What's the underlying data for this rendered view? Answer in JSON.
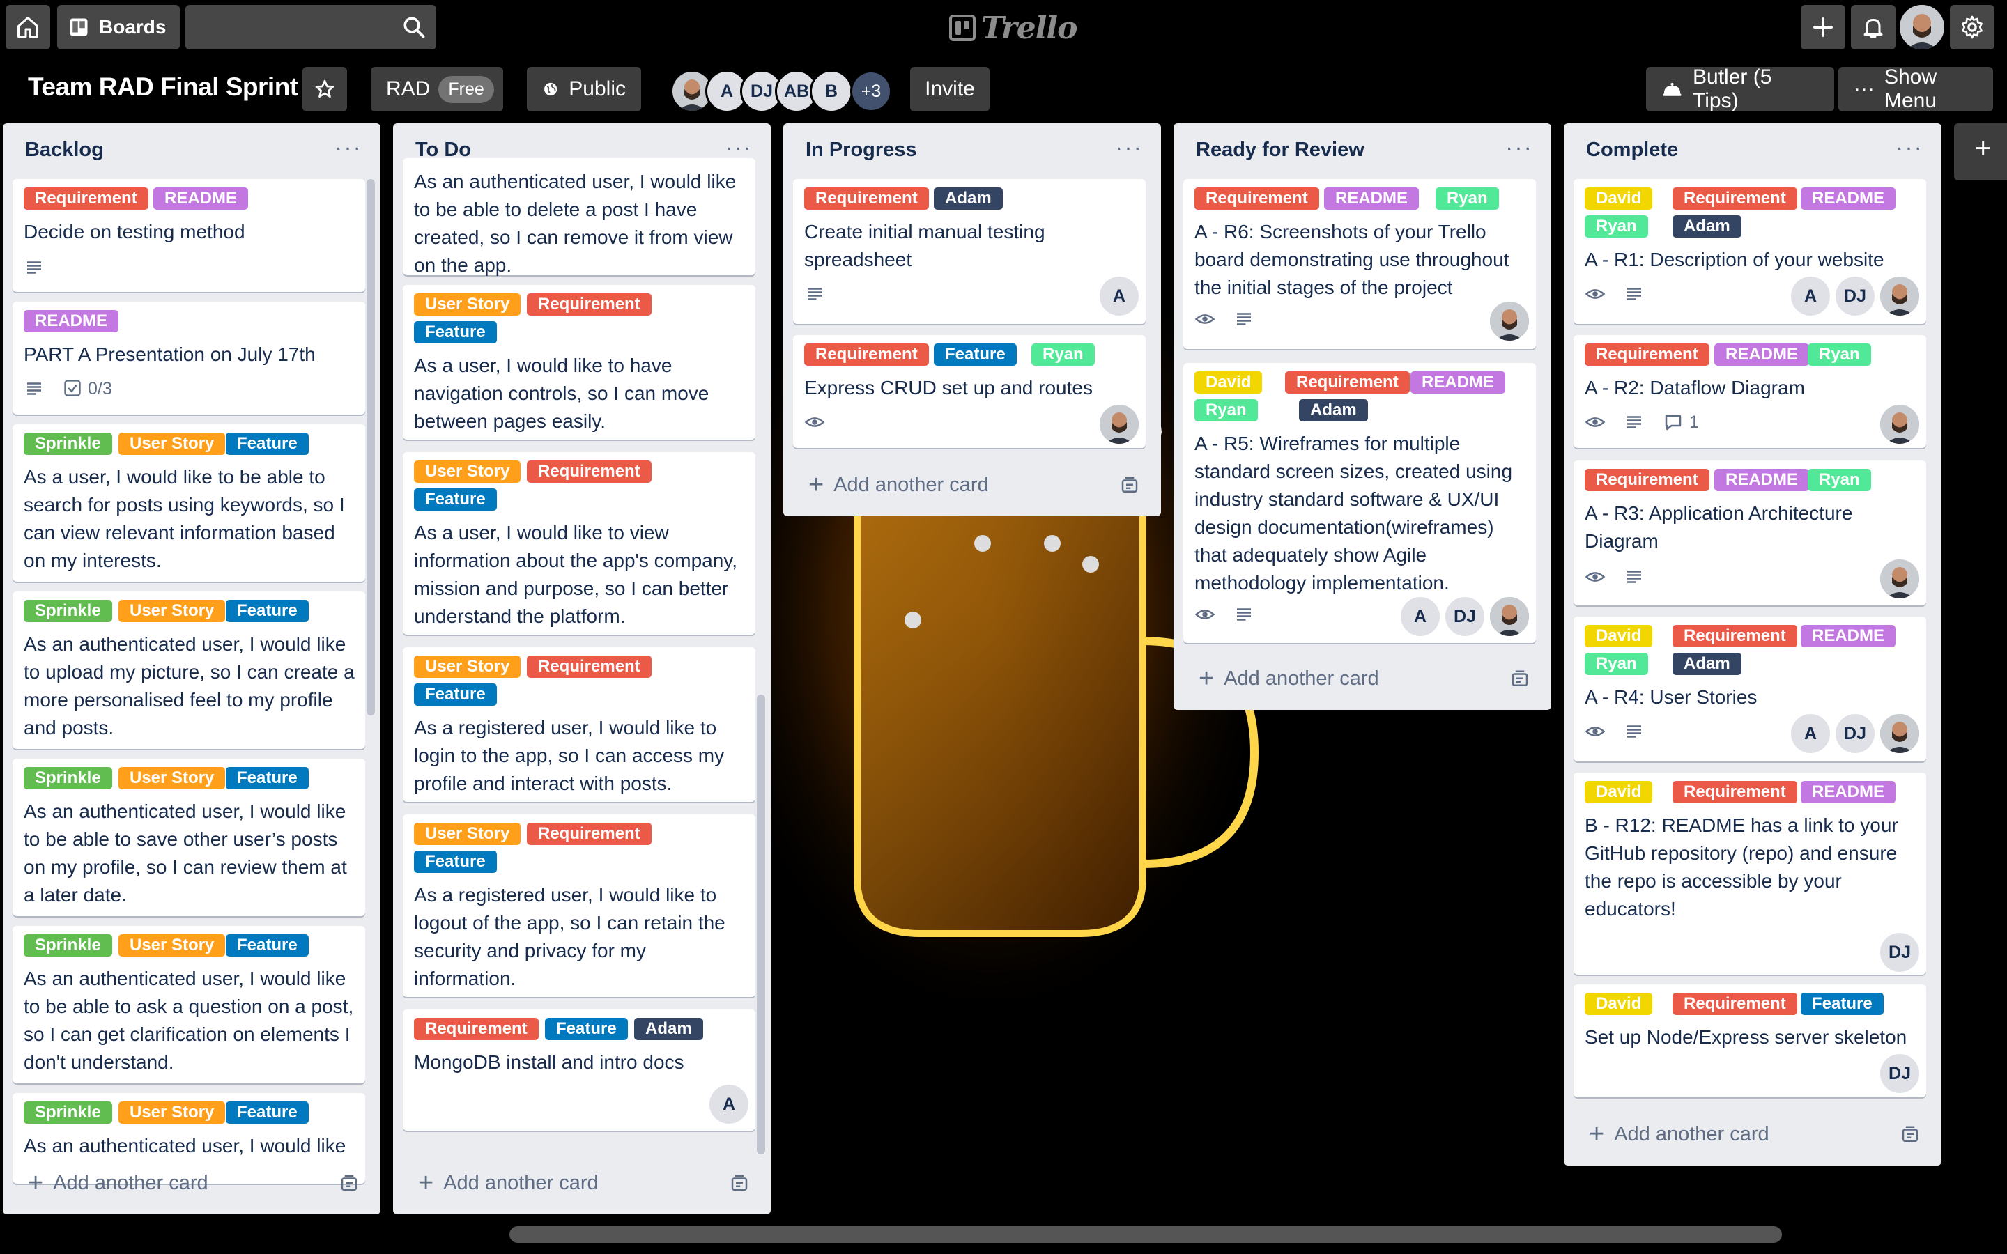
{
  "topbar": {
    "boards_label": "Boards",
    "search_value": "",
    "logo_text": "Trello"
  },
  "board": {
    "title": "Team RAD Final Sprint",
    "workspace_label": "RAD",
    "plan_label": "Free",
    "visibility_label": "Public",
    "members": [
      "A",
      "DJ",
      "AB",
      "B"
    ],
    "more_members": "+3",
    "invite_label": "Invite",
    "butler_label": "Butler (5 Tips)",
    "menu_label": "Show Menu"
  },
  "label_colors": {
    "Requirement": "#eb5a46",
    "README": "#c377e0",
    "Sprinkle": "#61bd4f",
    "User Story": "#ff9f1a",
    "Feature": "#0079bf",
    "Adam": "#344563",
    "Ryan": "#51e898",
    "David": "#f2d600"
  },
  "add_card_label": "Add another card",
  "lists": [
    {
      "title": "Backlog",
      "cards": [
        {
          "labels": [
            "Requirement",
            "README"
          ],
          "text": "Decide on testing method",
          "description": true
        },
        {
          "labels": [
            "README"
          ],
          "text": "PART A Presentation on July 17th",
          "description": true,
          "checklist": "0/3"
        },
        {
          "labels": [
            "Sprinkle",
            "User Story",
            "Feature"
          ],
          "text": "As a user, I would like to be able to search for posts using keywords, so I can view relevant information based on my interests."
        },
        {
          "labels": [
            "Sprinkle",
            "User Story",
            "Feature"
          ],
          "text": "As an authenticated user, I would like to upload my picture, so I can create a more personalised feel to my profile and posts."
        },
        {
          "labels": [
            "Sprinkle",
            "User Story",
            "Feature"
          ],
          "text": "As an authenticated user, I would like to be able to save other user’s posts on my profile, so I can review them at a later date."
        },
        {
          "labels": [
            "Sprinkle",
            "User Story",
            "Feature"
          ],
          "text": "As an authenticated user, I would like to be able to ask a question on a post, so I can get clarification on elements I don't understand."
        },
        {
          "labels": [
            "Sprinkle",
            "User Story",
            "Feature"
          ],
          "text": "As an authenticated user, I would like"
        }
      ]
    },
    {
      "title": "To Do",
      "cards": [
        {
          "labels": [],
          "text": "As an authenticated user, I would like to be able to delete a post I have created, so I can remove it from view on the app."
        },
        {
          "labels": [
            "User Story",
            "Requirement",
            "Feature"
          ],
          "text": "As a user, I would like to have navigation controls, so I can move between pages easily."
        },
        {
          "labels": [
            "User Story",
            "Requirement",
            "Feature"
          ],
          "text": "As a user, I would like to view information about the app's company, mission and purpose, so I can better understand the platform."
        },
        {
          "labels": [
            "User Story",
            "Requirement",
            "Feature"
          ],
          "text": "As a registered user, I would like to login to the app, so I can access my profile and interact with posts."
        },
        {
          "labels": [
            "User Story",
            "Requirement",
            "Feature"
          ],
          "text": "As a registered user, I would like to logout of the app, so I can retain the security and privacy for my information."
        },
        {
          "labels": [
            "Requirement",
            "Feature",
            "Adam"
          ],
          "text": "MongoDB install and intro docs",
          "members": [
            "A"
          ]
        }
      ]
    },
    {
      "title": "In Progress",
      "cards": [
        {
          "labels": [
            "Requirement",
            "Adam"
          ],
          "text": "Create initial manual testing spreadsheet",
          "description": true,
          "members": [
            "A"
          ]
        },
        {
          "labels": [
            "Requirement",
            "Feature",
            "Ryan"
          ],
          "text": "Express CRUD set up and routes",
          "watching": true,
          "members": [
            "photo"
          ]
        }
      ]
    },
    {
      "title": "Ready for Review",
      "cards": [
        {
          "labels": [
            "Requirement",
            "README",
            "Ryan"
          ],
          "text": "A - R6: Screenshots of your Trello board demonstrating use throughout the initial stages of the project",
          "watching": true,
          "description": true,
          "members": [
            "photo"
          ]
        },
        {
          "labels": [
            "David",
            "Requirement",
            "README",
            "Ryan",
            "Adam"
          ],
          "text": "A - R5: Wireframes for multiple standard screen sizes, created using industry standard software & UX/UI design documentation(wireframes) that adequately show Agile methodology implementation.",
          "watching": true,
          "description": true,
          "members": [
            "A",
            "DJ",
            "photo"
          ]
        }
      ]
    },
    {
      "title": "Complete",
      "cards": [
        {
          "labels": [
            "David",
            "Requirement",
            "README",
            "Ryan",
            "Adam"
          ],
          "text": "A - R1: Description of your website",
          "watching": true,
          "description": true,
          "members": [
            "A",
            "DJ",
            "photo"
          ]
        },
        {
          "labels": [
            "Requirement",
            "README",
            "Ryan"
          ],
          "text": "A - R2: Dataflow Diagram",
          "watching": true,
          "description": true,
          "comments": "1",
          "members": [
            "photo"
          ]
        },
        {
          "labels": [
            "Requirement",
            "README",
            "Ryan"
          ],
          "text": "A - R3: Application Architecture Diagram",
          "watching": true,
          "description": true,
          "members": [
            "photo"
          ]
        },
        {
          "labels": [
            "David",
            "Requirement",
            "README",
            "Ryan",
            "Adam"
          ],
          "text": "A - R4: User Stories",
          "watching": true,
          "description": true,
          "members": [
            "A",
            "DJ",
            "photo"
          ]
        },
        {
          "labels": [
            "David",
            "Requirement",
            "README"
          ],
          "text": "B - R12: README has a link to your GitHub repository (repo) and ensure the repo is accessible by your educators!",
          "members": [
            "DJ"
          ]
        },
        {
          "labels": [
            "David",
            "Requirement",
            "Feature"
          ],
          "text": "Set up Node/Express server skeleton",
          "members": [
            "DJ"
          ]
        }
      ]
    }
  ]
}
